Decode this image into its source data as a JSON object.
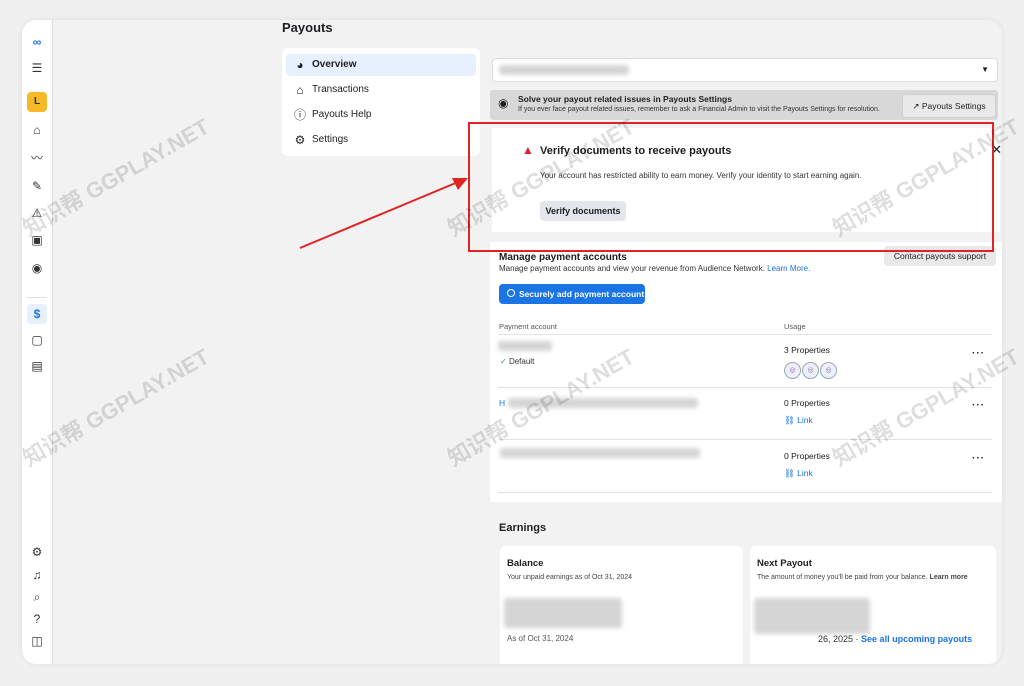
{
  "page": {
    "title": "Payouts"
  },
  "rail": {
    "icons": [
      "meta-logo",
      "menu",
      "account-badge",
      "home",
      "insights",
      "tools",
      "warning",
      "box",
      "shield",
      "dollar",
      "page",
      "book",
      "settings",
      "bell",
      "search",
      "help",
      "sidebar-toggle"
    ],
    "account_letter": "L",
    "active_glyph": "$"
  },
  "nav": {
    "items": [
      {
        "label": "Overview",
        "icon": "globe-icon",
        "active": true
      },
      {
        "label": "Transactions",
        "icon": "bank-icon",
        "active": false
      },
      {
        "label": "Payouts Help",
        "icon": "help-icon",
        "active": false
      },
      {
        "label": "Settings",
        "icon": "gear-icon",
        "active": false
      }
    ]
  },
  "info_bar": {
    "title": "Solve your payout related issues in Payouts Settings",
    "text": "If you ever face payout related issues, remember to ask a Financial Admin to visit the Payouts Settings for resolution.",
    "button": "Payouts Settings"
  },
  "verify": {
    "title": "Verify documents to receive payouts",
    "description": "Your account has restricted ability to earn money. Verify your identity to start earning again.",
    "button": "Verify documents"
  },
  "manage": {
    "title": "Manage payment accounts",
    "subtitle": "Manage payment accounts and view your revenue from Audience Network.",
    "learn_more": "Learn More.",
    "contact_button": "Contact payouts support",
    "add_button": "Securely add payment account",
    "col_account": "Payment account",
    "col_usage": "Usage",
    "rows": [
      {
        "default_label": "Default",
        "properties": "3 Properties"
      },
      {
        "account_prefix": "H",
        "properties": "0 Properties",
        "link": "Link"
      },
      {
        "properties": "0 Properties",
        "link": "Link"
      }
    ]
  },
  "earnings": {
    "title": "Earnings",
    "balance": {
      "title": "Balance",
      "subtitle": "Your unpaid earnings as of Oct 31, 2024",
      "as_of": "As of Oct 31, 2024"
    },
    "next_payout": {
      "title": "Next Payout",
      "subtitle": "The amount of money you'll be paid from your balance.",
      "learn_more": "Learn more",
      "date_fragment": "26, 2025 ·",
      "link": "See all upcoming payouts"
    }
  },
  "watermark": {
    "text": "知识帮 GGPLAY.NET"
  },
  "colors": {
    "accent": "#1b74e4",
    "highlight": "#e02424",
    "warning": "#e41e3f"
  }
}
